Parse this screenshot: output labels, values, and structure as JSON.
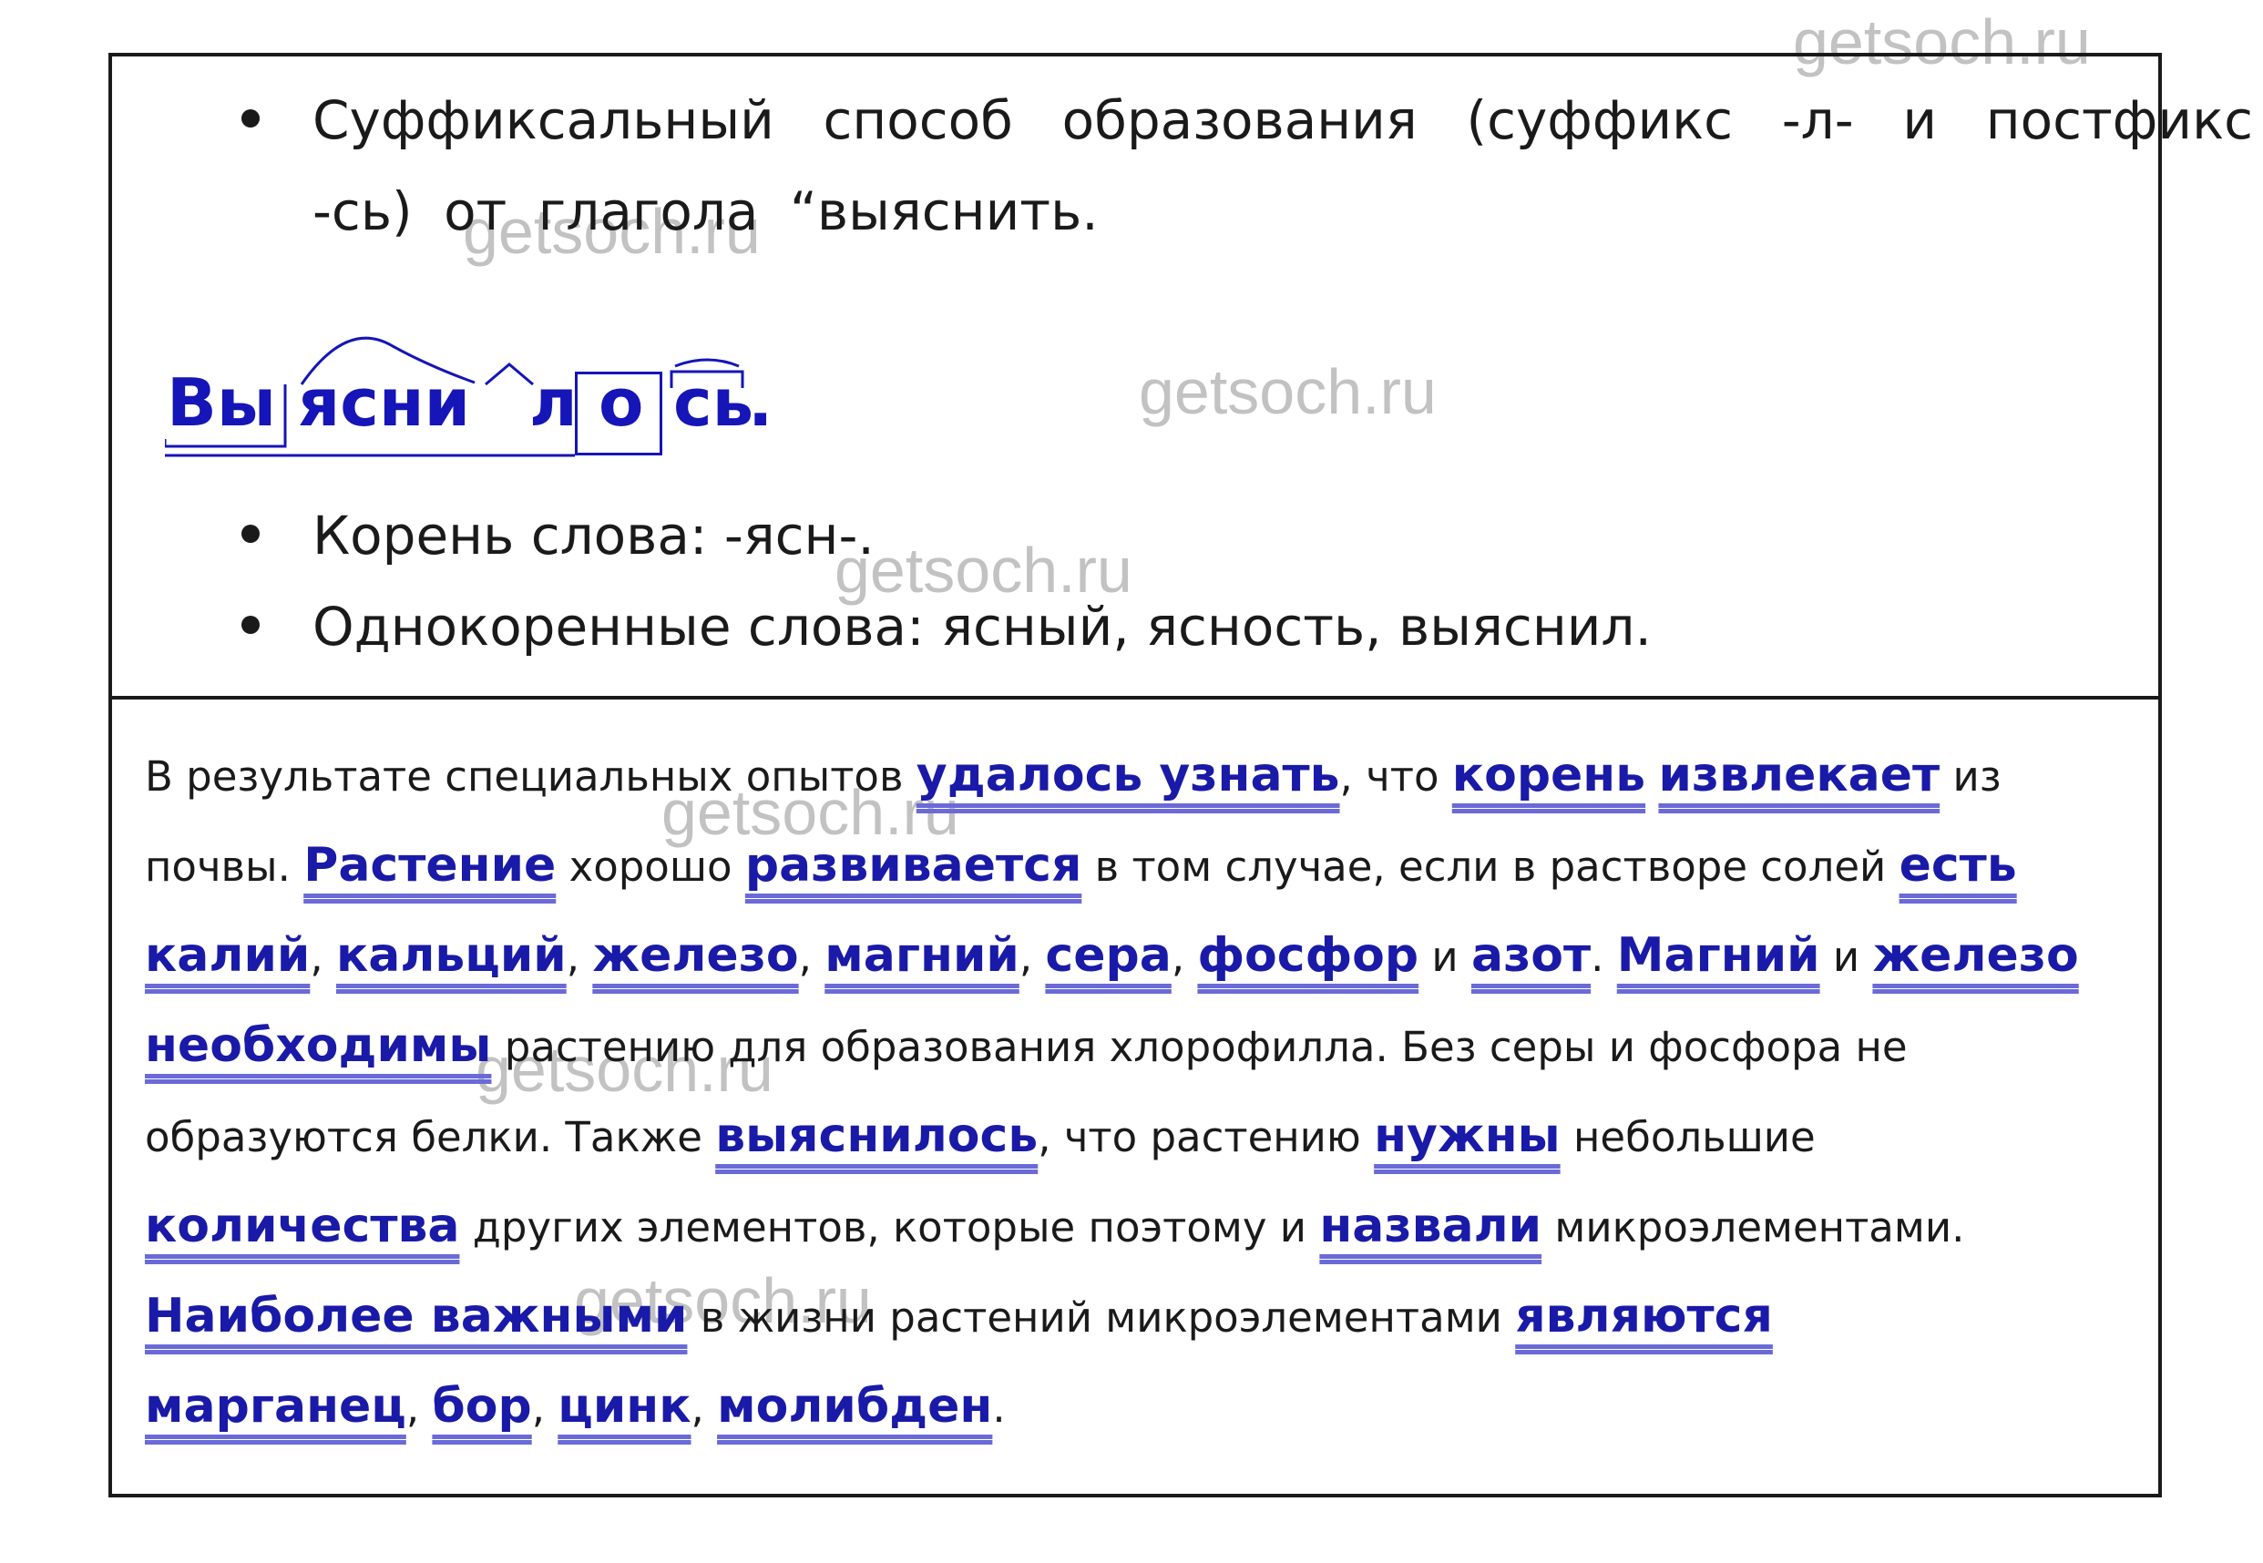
{
  "watermark": "getsoch.ru",
  "bullets": [
    {
      "text": "Суффиксальный способ образования (суффикс -л- и постфикс -сь) от глагола “выяснить."
    },
    {
      "text": "Корень слова: -ясн-."
    },
    {
      "text": "Однокоренные слова: ясный, ясность, выяснил."
    }
  ],
  "morpheme": {
    "prefix": "Вы",
    "root": "ясни",
    "suffix": "л",
    "ending": "о",
    "postfix": "сь",
    "end_mark": "."
  },
  "text_lines": [
    [
      {
        "t": "В результате специальных опытов "
      },
      {
        "t": "удалось узнать",
        "kw": true
      },
      {
        "t": ", что "
      },
      {
        "t": "корень",
        "kw": true
      },
      {
        "t": " "
      },
      {
        "t": "извлекает",
        "kw": true
      },
      {
        "t": " из"
      }
    ],
    [
      {
        "t": "почвы. "
      },
      {
        "t": "Растение",
        "kw": true
      },
      {
        "t": " хорошо "
      },
      {
        "t": "развивается",
        "kw": true
      },
      {
        "t": " в том случае, если в растворе солей "
      },
      {
        "t": "есть",
        "kw": true
      }
    ],
    [
      {
        "t": "калий",
        "kw": true
      },
      {
        "t": ", "
      },
      {
        "t": "кальций",
        "kw": true
      },
      {
        "t": ", "
      },
      {
        "t": "железо",
        "kw": true
      },
      {
        "t": ", "
      },
      {
        "t": "магний",
        "kw": true
      },
      {
        "t": ", "
      },
      {
        "t": "сера",
        "kw": true
      },
      {
        "t": ", "
      },
      {
        "t": "фосфор",
        "kw": true
      },
      {
        "t": " и "
      },
      {
        "t": "азот",
        "kw": true
      },
      {
        "t": ". "
      },
      {
        "t": "Магний",
        "kw": true
      },
      {
        "t": " и "
      },
      {
        "t": "железо",
        "kw": true
      }
    ],
    [
      {
        "t": "необходимы",
        "kw": true
      },
      {
        "t": " растению для образования хлорофилла. Без серы и фосфора не"
      }
    ],
    [
      {
        "t": "образуются белки. Также "
      },
      {
        "t": "выяснилось",
        "kw": true
      },
      {
        "t": ", что растению "
      },
      {
        "t": "нужны",
        "kw": true
      },
      {
        "t": " небольшие"
      }
    ],
    [
      {
        "t": "количества",
        "kw": true
      },
      {
        "t": " других элементов, которые поэтому и "
      },
      {
        "t": "назвали",
        "kw": true
      },
      {
        "t": " микроэлементами."
      }
    ],
    [
      {
        "t": "Наиболее важными",
        "kw": true
      },
      {
        "t": " в жизни растений микроэлементами "
      },
      {
        "t": "являются",
        "kw": true
      }
    ],
    [
      {
        "t": "марганец",
        "kw": true
      },
      {
        "t": ", "
      },
      {
        "t": "бор",
        "kw": true
      },
      {
        "t": ", "
      },
      {
        "t": "цинк",
        "kw": true
      },
      {
        "t": ", "
      },
      {
        "t": "молибден",
        "kw": true
      },
      {
        "t": "."
      }
    ]
  ]
}
